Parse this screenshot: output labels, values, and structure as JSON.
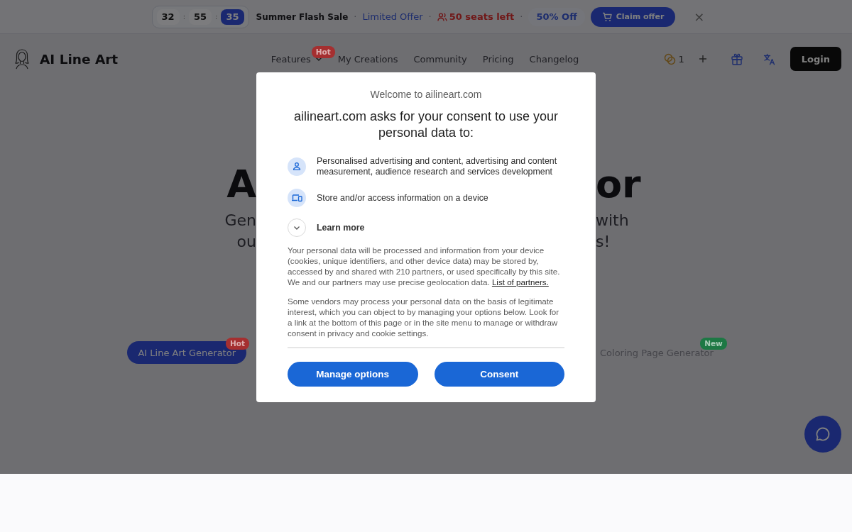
{
  "promo_bar": {
    "countdown": [
      {
        "kind": "unit",
        "text": "32",
        "highlighted": false
      },
      {
        "kind": "separator",
        "text": ":"
      },
      {
        "kind": "unit",
        "text": "55",
        "highlighted": false
      },
      {
        "kind": "separator",
        "text": ":"
      },
      {
        "kind": "unit",
        "text": "35",
        "highlighted": true
      }
    ],
    "items": [
      {
        "kind": "title",
        "text": "Summer Flash Sale"
      },
      {
        "kind": "dot",
        "text": "·"
      },
      {
        "kind": "offer",
        "text": "Limited Offer"
      },
      {
        "kind": "dot",
        "text": "·"
      },
      {
        "kind": "seats",
        "text": "50 seats left"
      },
      {
        "kind": "dot",
        "text": "·"
      },
      {
        "kind": "discount",
        "text": "50% Off"
      },
      {
        "kind": "button",
        "text": "Claim offer"
      },
      {
        "kind": "close",
        "text": "×"
      }
    ]
  },
  "nav": {
    "site_name": "AI Line Art",
    "links": [
      {
        "kind": "dropdown",
        "label": "Features",
        "badge": {
          "text": "Hot",
          "color": "#a52f30"
        }
      },
      {
        "kind": "link",
        "label": "My Creations"
      },
      {
        "kind": "link",
        "label": "Community"
      },
      {
        "kind": "link",
        "label": "Pricing"
      },
      {
        "kind": "link",
        "label": "Changelog"
      }
    ],
    "credits": "1",
    "login": "Login"
  },
  "hero": {
    "title_fragments": [
      "A",
      "or"
    ],
    "subtitle_lines": [
      [
        "Gen",
        "with"
      ],
      [
        "ou",
        "s!"
      ]
    ],
    "tabs": [
      {
        "label": "AI Line Art Generator",
        "selected": true,
        "badge": {
          "text": "Hot",
          "color": "#a52f30"
        }
      },
      {
        "label": "Coloring Page Generator",
        "selected": false,
        "badge": {
          "text": "New",
          "color": "#1d7844"
        }
      }
    ]
  },
  "consent_dialog": {
    "welcome": "Welcome to ailineart.com",
    "heading": "ailineart.com asks for your consent to use your personal data to:",
    "purposes": [
      {
        "kind": "person",
        "text": "Personalised advertising and content, advertising and content measurement, audience research and services development"
      },
      {
        "kind": "device",
        "text": "Store and/or access information on a device"
      }
    ],
    "learn_more": {
      "text": "Learn more",
      "expanded": false
    },
    "paragraphs": [
      {
        "text": "Your personal data will be processed and information from your device (cookies, unique identifiers, and other device data) may be stored by, accessed by and shared with 210 partners, or used specifically by this site. We and our partners may use precise geolocation data.",
        "link": "List of partners."
      },
      {
        "text": "Some vendors may process your personal data on the basis of legitimate interest, which you can object to by managing your options below. Look for a link at the bottom of this page or in the site menu to manage or withdraw consent in privacy and cookie settings."
      }
    ],
    "buttons": [
      "Manage options",
      "Consent"
    ]
  }
}
